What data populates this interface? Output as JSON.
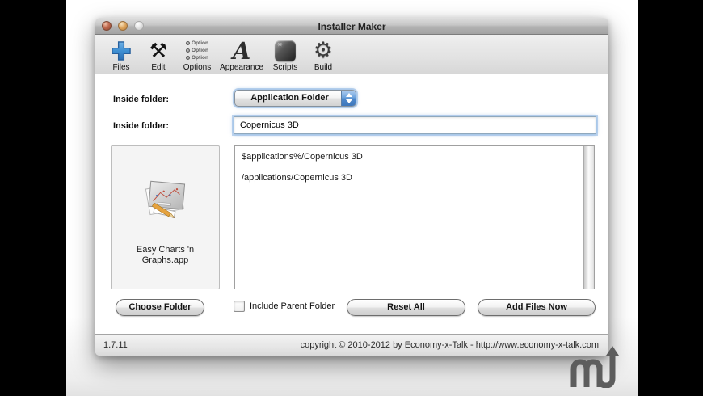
{
  "page": {
    "background": "#000000",
    "panel_background": "#ffffff"
  },
  "window": {
    "title": "Installer Maker",
    "traffic_lights": [
      "close",
      "minimize",
      "zoom"
    ],
    "toolbar": {
      "option_text": "Option",
      "items": [
        {
          "label": "Files",
          "icon": "plus-icon"
        },
        {
          "label": "Edit",
          "icon": "tools-icon"
        },
        {
          "label": "Options",
          "icon": "options-list-icon"
        },
        {
          "label": "Appearance",
          "icon": "letter-a-icon"
        },
        {
          "label": "Scripts",
          "icon": "scripts-icon"
        },
        {
          "label": "Build",
          "icon": "gear-icon"
        }
      ]
    },
    "form": {
      "popup_label": "Inside folder:",
      "popup_value": "Application Folder",
      "field_label": "Inside folder:",
      "field_value": "Copernicus 3D"
    },
    "file_box": {
      "file_name_line1": "Easy Charts 'n",
      "file_name_line2": "Graphs.app"
    },
    "paths_area": {
      "lines": [
        "$applications%/Copernicus 3D",
        "/applications/Copernicus 3D"
      ]
    },
    "actions": {
      "choose_folder": "Choose Folder",
      "include_parent_label": "Include Parent Folder",
      "include_parent_checked": false,
      "reset_all": "Reset All",
      "add_files_now": "Add Files Now"
    },
    "status_bar": {
      "version": "1.7.11",
      "copyright": "copyright © 2010-2012 by Economy-x-Talk - http://www.economy-x-talk.com"
    }
  },
  "badge": {
    "name": "macupdate-logo"
  },
  "colors": {
    "accent_blue": "#4d88cc",
    "focus_ring": "#7ba9de",
    "titlebar_top": "#dedede",
    "titlebar_bottom": "#a2a2a2",
    "toolbar_bg": "#e2e2e2",
    "status_text": "#2b2b2b",
    "files_plus_blue": "#3f8fd2"
  }
}
